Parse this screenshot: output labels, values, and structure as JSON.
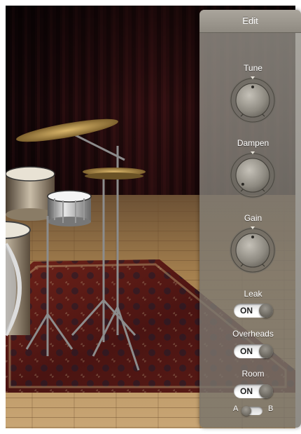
{
  "panel": {
    "title": "Edit",
    "controls": [
      {
        "label": "Tune",
        "type": "knob",
        "value": 0.5
      },
      {
        "label": "Dampen",
        "type": "knob",
        "value": 0.06
      },
      {
        "label": "Gain",
        "type": "knob",
        "value": 0.5
      },
      {
        "label": "Leak",
        "type": "toggle",
        "state": "ON"
      },
      {
        "label": "Overheads",
        "type": "toggle",
        "state": "ON"
      },
      {
        "label": "Room",
        "type": "toggle",
        "state": "ON"
      }
    ],
    "ab_switch": {
      "left_label": "A",
      "right_label": "B",
      "selected": "A"
    }
  },
  "colors": {
    "panel": "#8f8a81",
    "text": "#ffffff",
    "curtain": "#2a0c0d",
    "floor": "#b18c5c",
    "rug": "#5a1a16"
  }
}
